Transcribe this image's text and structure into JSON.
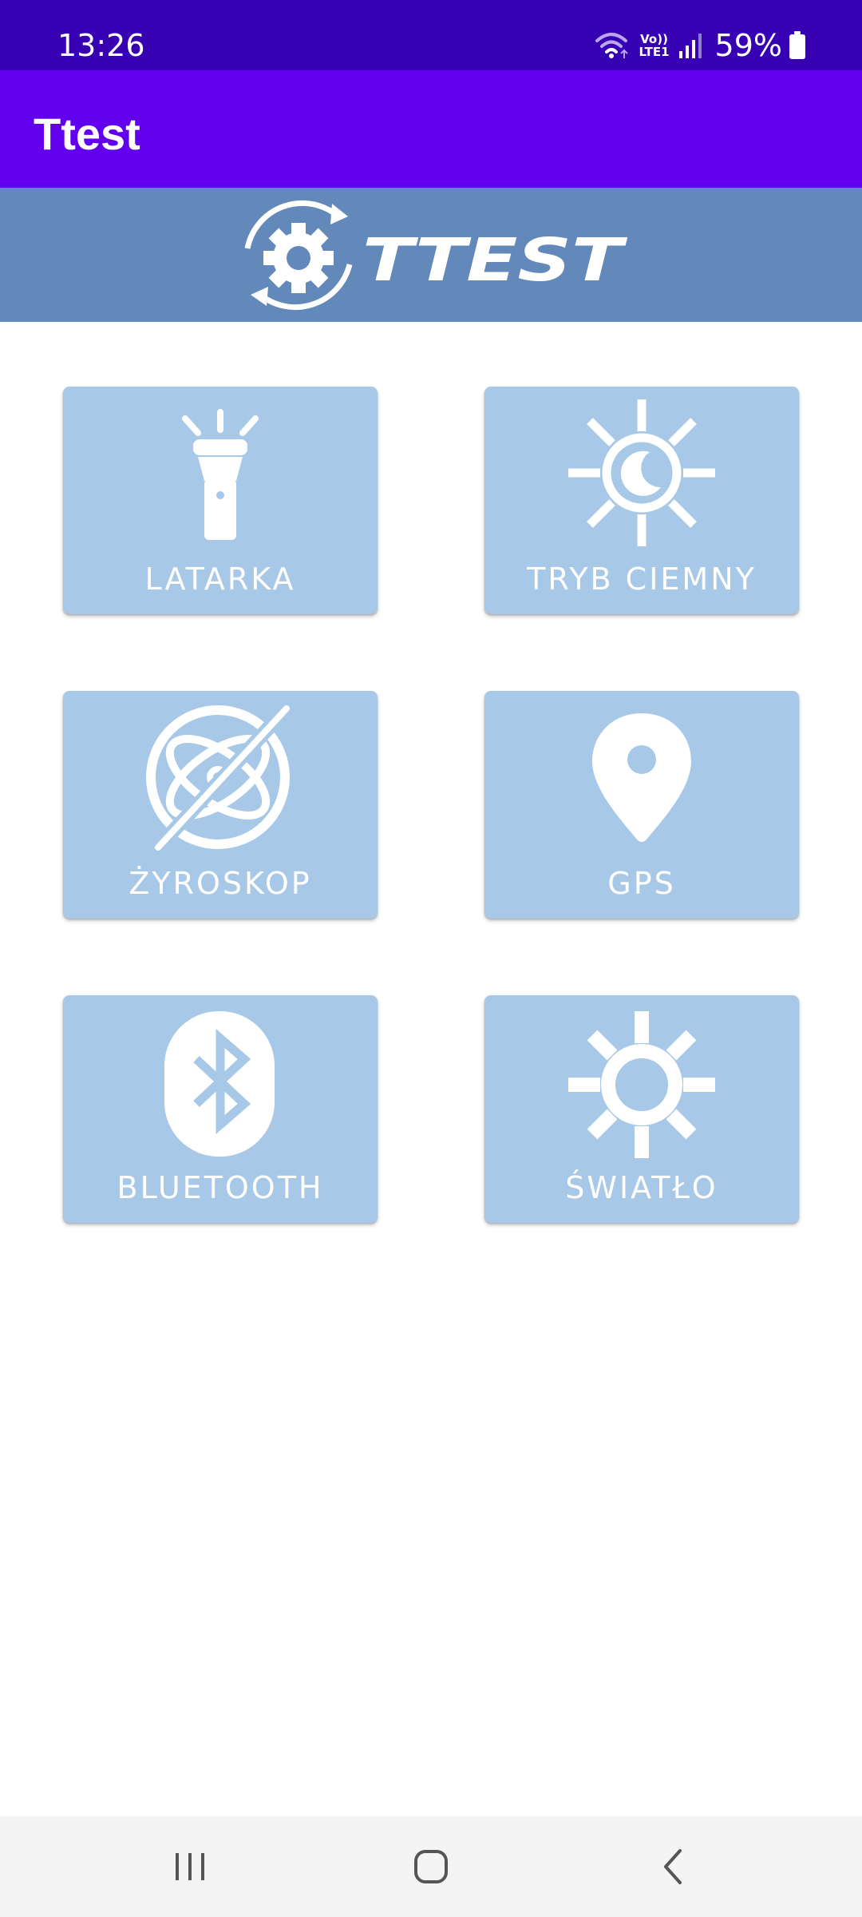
{
  "status_bar": {
    "time": "13:26",
    "volte_line1": "Vo))",
    "volte_line2": "LTE1",
    "battery": "59%",
    "icons": [
      "wifi-icon",
      "volte-icon",
      "signal-icon",
      "battery-icon"
    ]
  },
  "app_bar": {
    "title": "Ttest"
  },
  "banner": {
    "logo_text": "TTEST",
    "icon": "gear-refresh-logo"
  },
  "tiles": [
    {
      "label": "LATARKA",
      "icon": "flashlight-icon"
    },
    {
      "label": "TRYB CIEMNY",
      "icon": "dark-mode-icon"
    },
    {
      "label": "ŻYROSKOP",
      "icon": "gyroscope-off-icon"
    },
    {
      "label": "GPS",
      "icon": "location-pin-icon"
    },
    {
      "label": "BLUETOOTH",
      "icon": "bluetooth-icon"
    },
    {
      "label": "ŚWIATŁO",
      "icon": "light-sensor-icon"
    }
  ],
  "nav_bar": {
    "icons": [
      "recents-icon",
      "home-icon",
      "back-icon"
    ]
  },
  "colors": {
    "status_bar": "#3700b3",
    "app_bar": "#6200ee",
    "banner": "#6388ba",
    "tile": "#a8c8e8",
    "tile_content": "#ffffff",
    "nav_bar": "#f4f4f4"
  }
}
